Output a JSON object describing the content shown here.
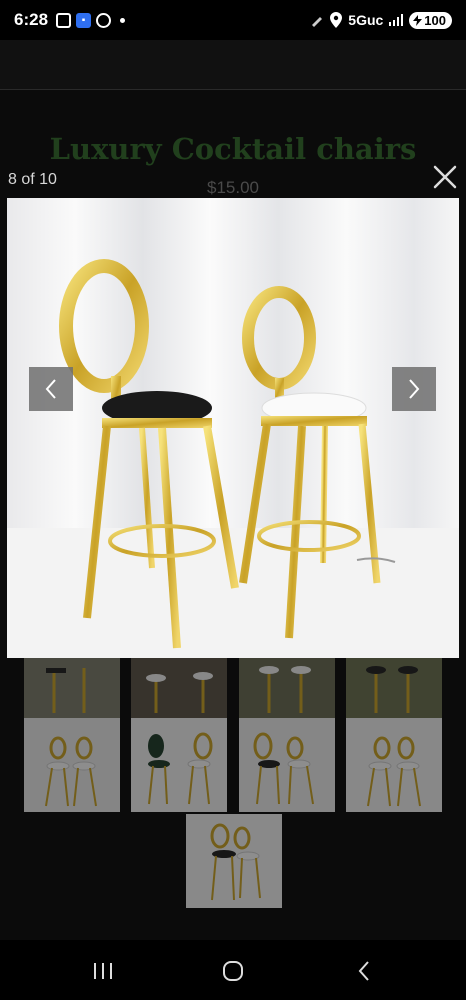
{
  "status_bar": {
    "time": "6:28",
    "network": "5Guc",
    "battery": "100",
    "icons": [
      "message-icon",
      "app-icon",
      "whatsapp-icon",
      "notification-dot",
      "edit-icon",
      "location-icon",
      "signal-icon",
      "battery-icon"
    ]
  },
  "page": {
    "title": "Luxury Cocktail chairs",
    "price": "$15.00"
  },
  "lightbox": {
    "counter": "8 of 10",
    "close_icon": "close-icon",
    "prev_icon": "chevron-left-icon",
    "next_icon": "chevron-right-icon"
  },
  "thumbnails": [
    {
      "alt": "thumbnail-1"
    },
    {
      "alt": "thumbnail-2"
    },
    {
      "alt": "thumbnail-3"
    },
    {
      "alt": "thumbnail-4"
    },
    {
      "alt": "thumbnail-5"
    },
    {
      "alt": "thumbnail-6"
    },
    {
      "alt": "thumbnail-7"
    },
    {
      "alt": "thumbnail-8"
    },
    {
      "alt": "thumbnail-9"
    }
  ],
  "colors": {
    "heading_green": "#21401d",
    "gold": "#d4af37",
    "overlay_button": "#6e6e6e"
  }
}
